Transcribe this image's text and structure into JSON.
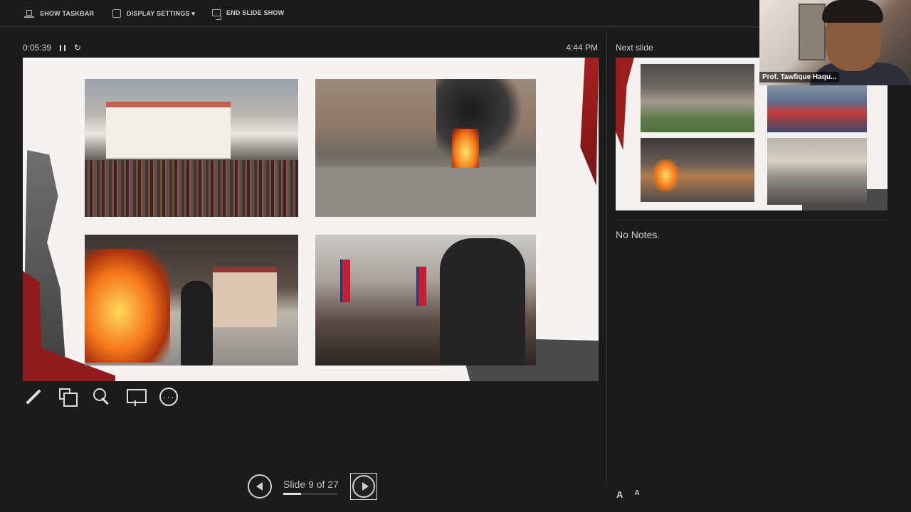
{
  "topbar": {
    "show_taskbar": "SHOW TASKBAR",
    "display_settings": "DISPLAY SETTINGS ▾",
    "end_slide_show": "END SLIDE SHOW"
  },
  "presenter": {
    "elapsed_time": "0:05:39",
    "clock": "4:44 PM",
    "next_slide_label": "Next slide",
    "notes": "No Notes."
  },
  "navigation": {
    "slide_counter": "Slide 9 of 27",
    "current_slide": 9,
    "total_slides": 27,
    "progress_fraction": 0.333
  },
  "font_controls": {
    "increase": "A",
    "decrease": "A"
  },
  "webcam": {
    "participant_name": "Prof. Tawfique Haqu..."
  },
  "icons": [
    "taskbar-icon",
    "display-icon",
    "end-show-icon",
    "pause-icon",
    "restart-icon",
    "pen-icon",
    "see-all-slides-icon",
    "zoom-icon",
    "screen-icon",
    "more-icon",
    "previous-icon",
    "next-icon"
  ]
}
